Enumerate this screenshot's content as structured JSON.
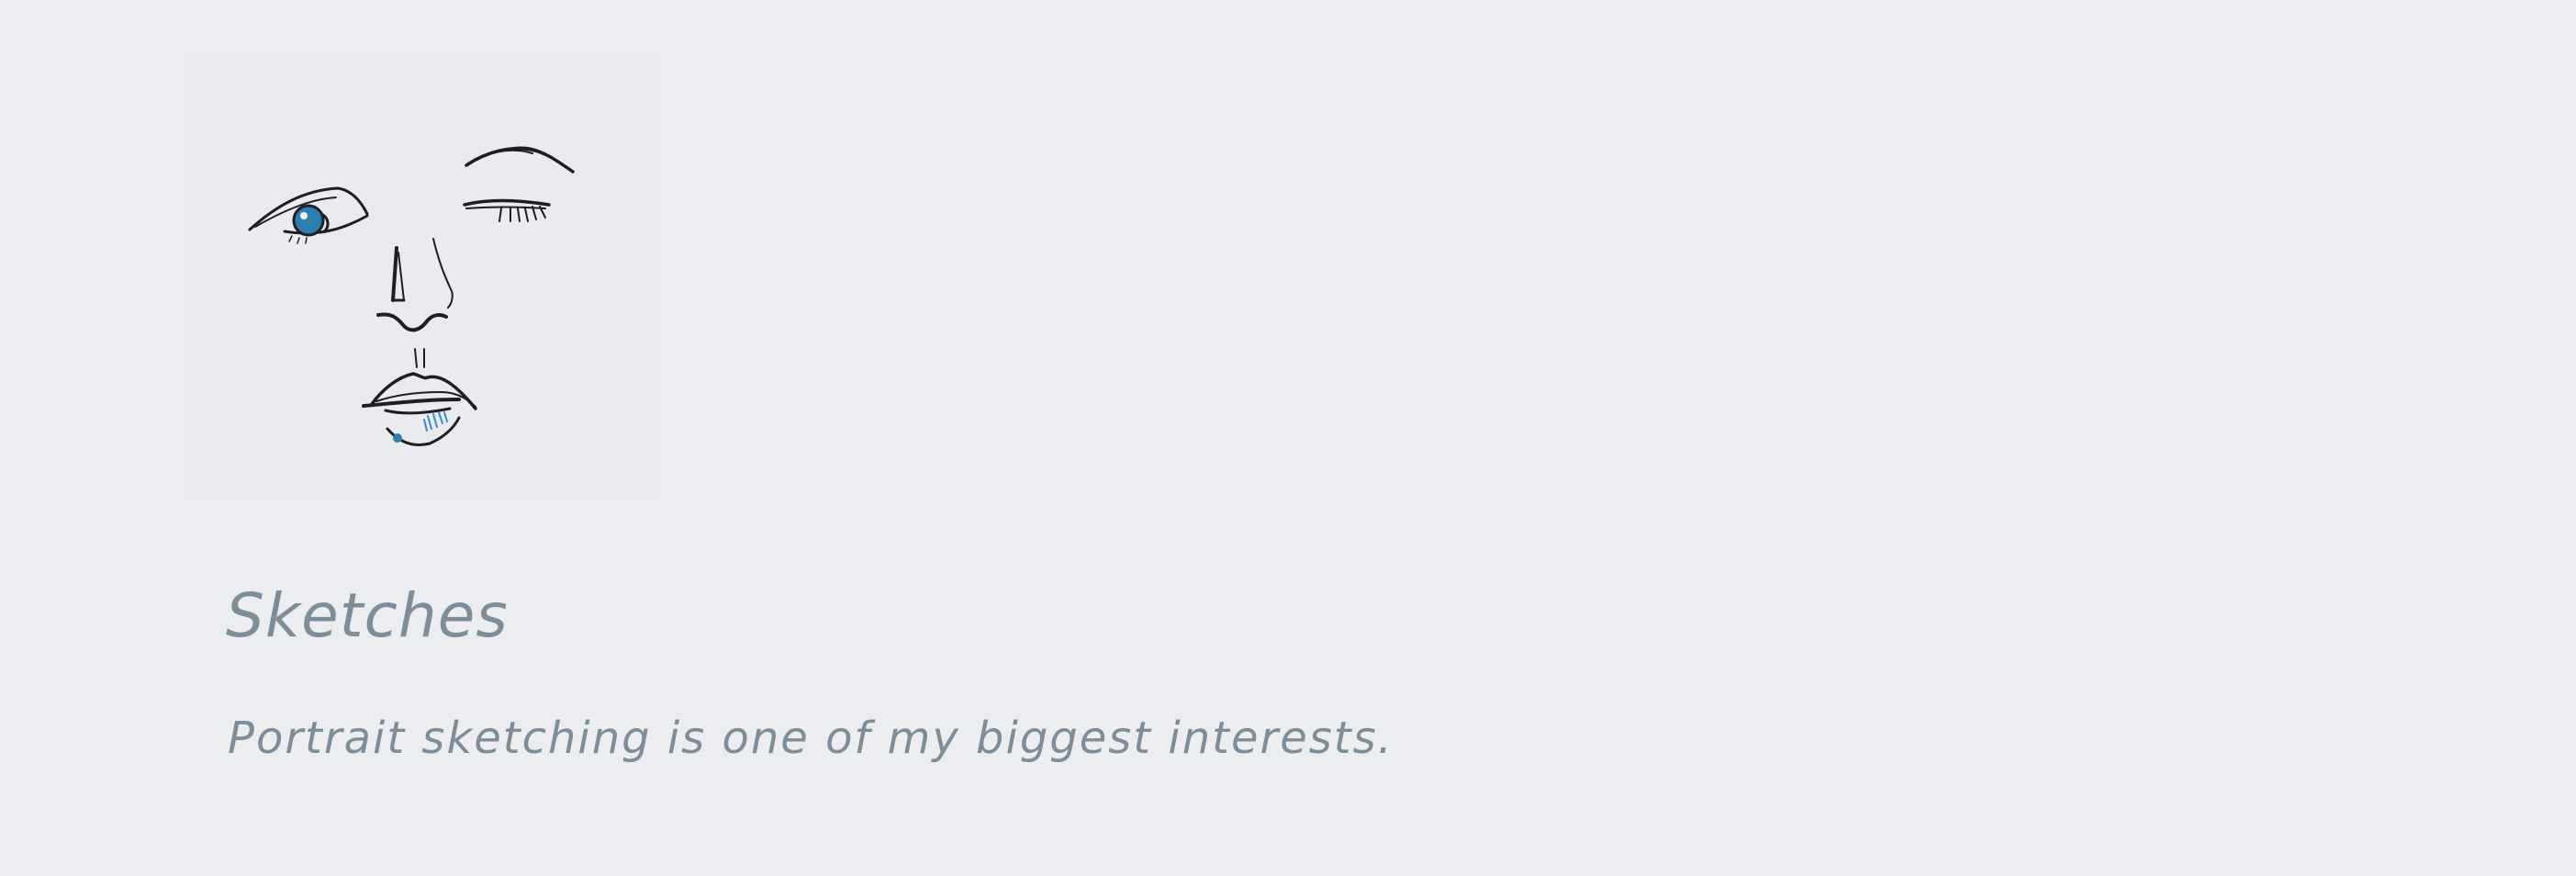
{
  "project": {
    "title": "Sketches",
    "description": "Portrait sketching is one of my biggest interests.",
    "image_icon": "portrait-sketch-icon"
  },
  "colors": {
    "background": "#ecedf1",
    "text": "#7d8d99",
    "ink": "#1f1f22",
    "accent_blue": "#2d7fb0"
  }
}
